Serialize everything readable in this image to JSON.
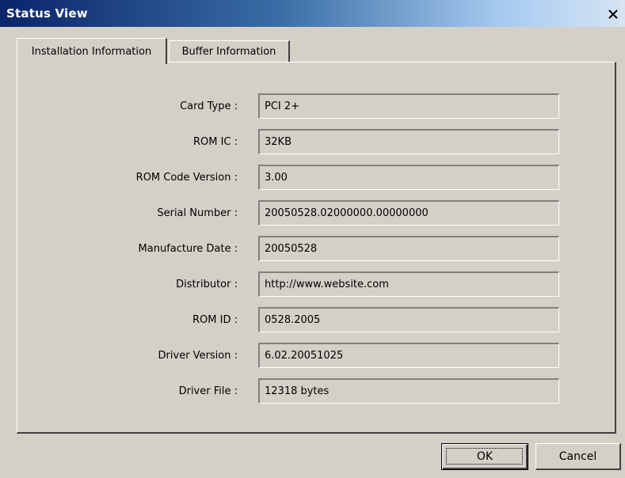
{
  "window": {
    "title": "Status View",
    "close_symbol": "close-icon"
  },
  "tabs": [
    {
      "label": "Installation Information",
      "active": true
    },
    {
      "label": "Buffer Information",
      "active": false
    }
  ],
  "fields": [
    {
      "label": "Card Type :",
      "value": "PCI 2+"
    },
    {
      "label": "ROM IC :",
      "value": "32KB"
    },
    {
      "label": "ROM Code Version :",
      "value": "3.00"
    },
    {
      "label": "Serial Number :",
      "value": "20050528.02000000.00000000"
    },
    {
      "label": "Manufacture Date :",
      "value": "20050528"
    },
    {
      "label": "Distributor :",
      "value": "http://www.website.com"
    },
    {
      "label": "ROM ID :",
      "value": "0528.2005"
    },
    {
      "label": "Driver Version :",
      "value": "6.02.20051025"
    },
    {
      "label": "Driver File :",
      "value": "12318 bytes"
    }
  ],
  "buttons": {
    "ok_label": "OK",
    "cancel_label": "Cancel"
  },
  "colors": {
    "title_bar_start": "#0a246a",
    "title_bar_end": "#d6e4f3",
    "dialog_face": "#d4d0c8"
  }
}
